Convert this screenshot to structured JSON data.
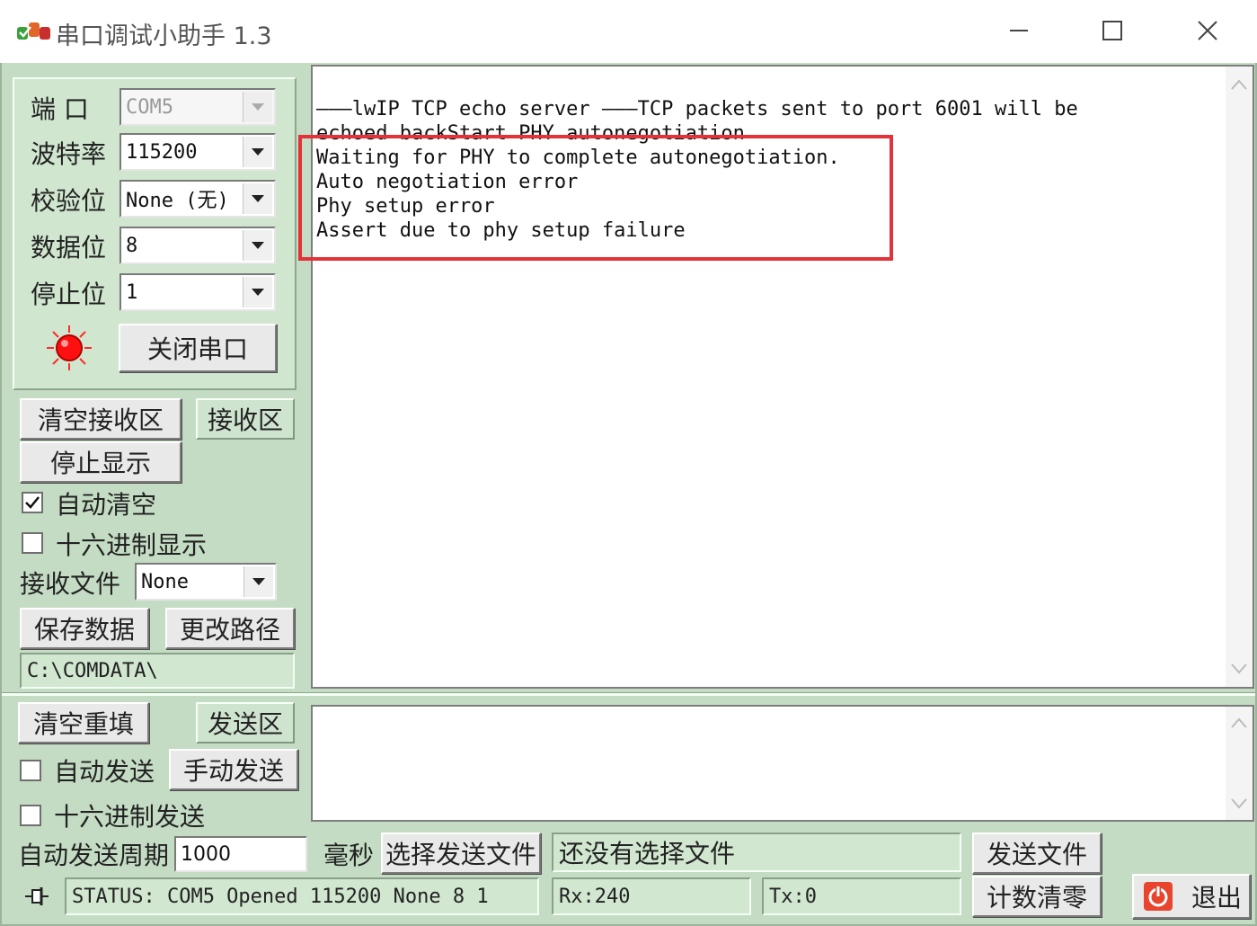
{
  "window": {
    "title": "串口调试小助手 1.3",
    "controls": {
      "minimize": "minimize-icon",
      "maximize": "maximize-icon",
      "close": "close-icon"
    }
  },
  "port_settings": {
    "port_label": "端  口",
    "port_value": "COM5",
    "baud_label": "波特率",
    "baud_value": "115200",
    "parity_label": "校验位",
    "parity_value": "None (无)",
    "databits_label": "数据位",
    "databits_value": "8",
    "stopbits_label": "停止位",
    "stopbits_value": "1",
    "status_led_color": "#ff0000",
    "close_port_label": "关闭串口"
  },
  "receive_controls": {
    "clear_receive_label": "清空接收区",
    "receive_area_label": "接收区",
    "stop_display_label": "停止显示",
    "auto_clear_label": "自动清空",
    "auto_clear_checked": true,
    "hex_display_label": "十六进制显示",
    "hex_display_checked": false,
    "receive_file_label": "接收文件",
    "receive_file_value": "None",
    "save_data_label": "保存数据",
    "change_path_label": "更改路径",
    "path_value": "C:\\COMDATA\\"
  },
  "receive_area": {
    "lines": [
      "———lwIP TCP echo server ———TCP packets sent to port 6001 will be",
      "echoed backStart PHY autonegotiation",
      "Waiting for PHY to complete autonegotiation.",
      "Auto negotiation error",
      "Phy setup error",
      "Assert due to phy setup failure"
    ],
    "highlight_color": "#e3323a"
  },
  "send_controls": {
    "clear_refill_label": "清空重填",
    "send_area_label": "发送区",
    "auto_send_label": "自动发送",
    "auto_send_checked": false,
    "manual_send_label": "手动发送",
    "hex_send_label": "十六进制发送",
    "hex_send_checked": false,
    "auto_period_label": "自动发送周期",
    "auto_period_value": "1000",
    "ms_label": "毫秒",
    "select_file_label": "选择发送文件",
    "file_status": "还没有选择文件",
    "send_file_label": "发送文件"
  },
  "status_bar": {
    "status_text": "STATUS: COM5 Opened 115200 None  8 1",
    "rx_text": "Rx:240",
    "tx_text": "Tx:0",
    "reset_count_label": "计数清零",
    "exit_label": "退出"
  }
}
